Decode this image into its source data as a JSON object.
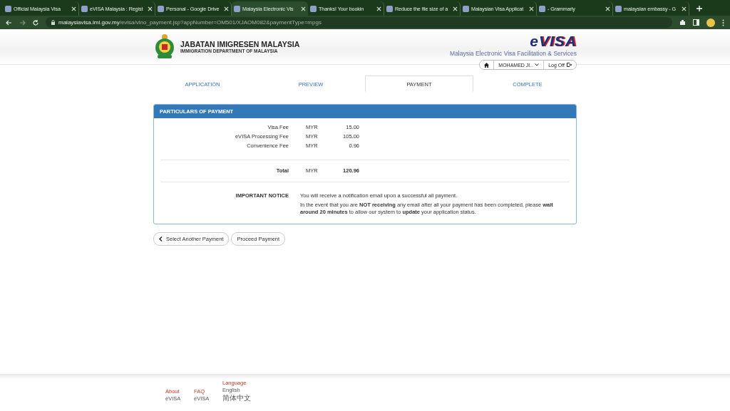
{
  "browser": {
    "tabs": [
      {
        "title": "Official Malaysia Visa",
        "selected": false
      },
      {
        "title": "eVISA Malaysia : Regist",
        "selected": false
      },
      {
        "title": "Personal - Google Drive",
        "selected": false
      },
      {
        "title": "Malaysia Electronic Vis",
        "selected": true
      },
      {
        "title": "Thanks! Your bookin",
        "selected": false
      },
      {
        "title": "Reduce the file size of a",
        "selected": false
      },
      {
        "title": "Malaysian Visa Applicat",
        "selected": false
      },
      {
        "title": "- Grammarly",
        "selected": false
      },
      {
        "title": "malaysian embassy - G",
        "selected": false
      }
    ],
    "url_host": "malaysiavisa.imi.gov.my",
    "url_path": "/evisa/vlno_payment.jsp?appNumber=OM501/XJAOM082&paymentType=mpgs"
  },
  "header": {
    "org_name": "JABATAN IMIGRESEN MALAYSIA",
    "org_subtitle": "IMMIGRATION DEPARTMENT OF MALAYSIA",
    "brand_e": "e",
    "brand_rest": "VISA",
    "tagline": "Malaysia Electronic Visa Facilitation & Services",
    "user": "MOHAMED JI..",
    "logout": "Log Off"
  },
  "steps": [
    {
      "label": "APPLICATION",
      "selected": false
    },
    {
      "label": "PREVIEW",
      "selected": false
    },
    {
      "label": "PAYMENT",
      "selected": true
    },
    {
      "label": "COMPLETE",
      "selected": false
    }
  ],
  "panel": {
    "title": "PARTICULARS OF PAYMENT",
    "fees": [
      {
        "label": "Visa Fee",
        "currency": "MYR",
        "amount": "15.00"
      },
      {
        "label": "eVISA Processing Fee",
        "currency": "MYR",
        "amount": "105.00"
      },
      {
        "label": "Convenience Fee",
        "currency": "MYR",
        "amount": "0.96"
      }
    ],
    "total": {
      "label": "Total",
      "currency": "MYR",
      "amount": "120.96"
    },
    "notice": {
      "label": "IMPORTANT NOTICE",
      "lines": [
        "You will receive a notification email upon a successful all payment.",
        "In the event that you are **NOT receiving** any email after all your payment has been completed, please **wait around 20 minutes** to allow our system to **update** your application status."
      ]
    }
  },
  "buttons": [
    {
      "label": "Select Another Payment",
      "kind": "back"
    },
    {
      "label": "Proceed Payment",
      "kind": "plain"
    }
  ],
  "footer": {
    "columns": [
      {
        "heading": "About",
        "items": [
          "eVISA"
        ]
      },
      {
        "heading": "FAQ",
        "items": [
          "eVISA"
        ]
      },
      {
        "heading": "Language",
        "items": [
          "English",
          "简体中文"
        ]
      }
    ]
  }
}
